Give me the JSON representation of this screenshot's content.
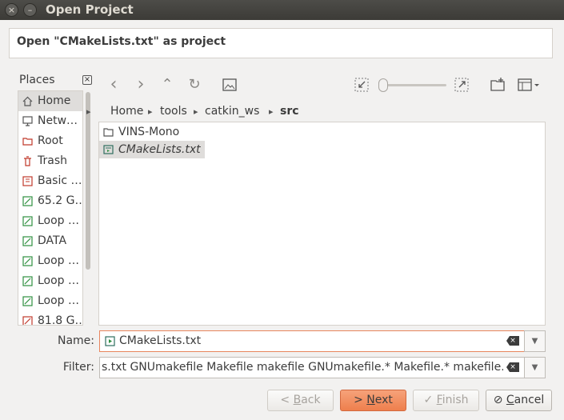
{
  "window": {
    "title": "Open Project",
    "close_glyph": "×",
    "minimize_glyph": "–"
  },
  "header": {
    "message": "Open \"CMakeLists.txt\" as project"
  },
  "places": {
    "title": "Places",
    "close_glyph": "×",
    "items": [
      {
        "label": "Home",
        "icon": "home-icon"
      },
      {
        "label": "Netw…",
        "icon": "network-icon"
      },
      {
        "label": "Root",
        "icon": "root-folder-icon"
      },
      {
        "label": "Trash",
        "icon": "trash-icon"
      },
      {
        "label": "Basic …",
        "icon": "bookmark-folder-icon"
      },
      {
        "label": "65.2 G…",
        "icon": "drive-icon"
      },
      {
        "label": "Loop …",
        "icon": "drive-icon"
      },
      {
        "label": "DATA",
        "icon": "drive-icon"
      },
      {
        "label": "Loop …",
        "icon": "drive-icon"
      },
      {
        "label": "Loop …",
        "icon": "drive-icon"
      },
      {
        "label": "Loop …",
        "icon": "drive-icon"
      },
      {
        "label": "81.8 G…",
        "icon": "drive-icon"
      }
    ]
  },
  "toolbar": {
    "back": "‹",
    "forward": "›",
    "up": "⌃",
    "reload": "↻"
  },
  "breadcrumb": [
    "Home",
    "tools",
    "catkin_ws",
    "src"
  ],
  "files": [
    {
      "name": "VINS-Mono",
      "type": "folder"
    },
    {
      "name": "CMakeLists.txt",
      "type": "file"
    }
  ],
  "name_field": {
    "label": "Name:",
    "value": "CMakeLists.txt"
  },
  "filter_field": {
    "label": "Filter:",
    "value": "s.txt GNUmakefile Makefile makefile GNUmakefile.* Makefile.* makefile.*)"
  },
  "buttons": {
    "back": {
      "prefix": "< ",
      "accel": "B",
      "rest": "ack"
    },
    "next": {
      "prefix": "> ",
      "accel": "N",
      "rest": "ext"
    },
    "finish": {
      "prefix": "✓ ",
      "accel": "F",
      "rest": "inish"
    },
    "cancel": {
      "prefix": "⊘ ",
      "accel": "C",
      "rest": "ancel"
    }
  },
  "colors": {
    "accent": "#ee7f4d",
    "titlebar": "#3c3b37",
    "selection": "#dfdddb"
  }
}
